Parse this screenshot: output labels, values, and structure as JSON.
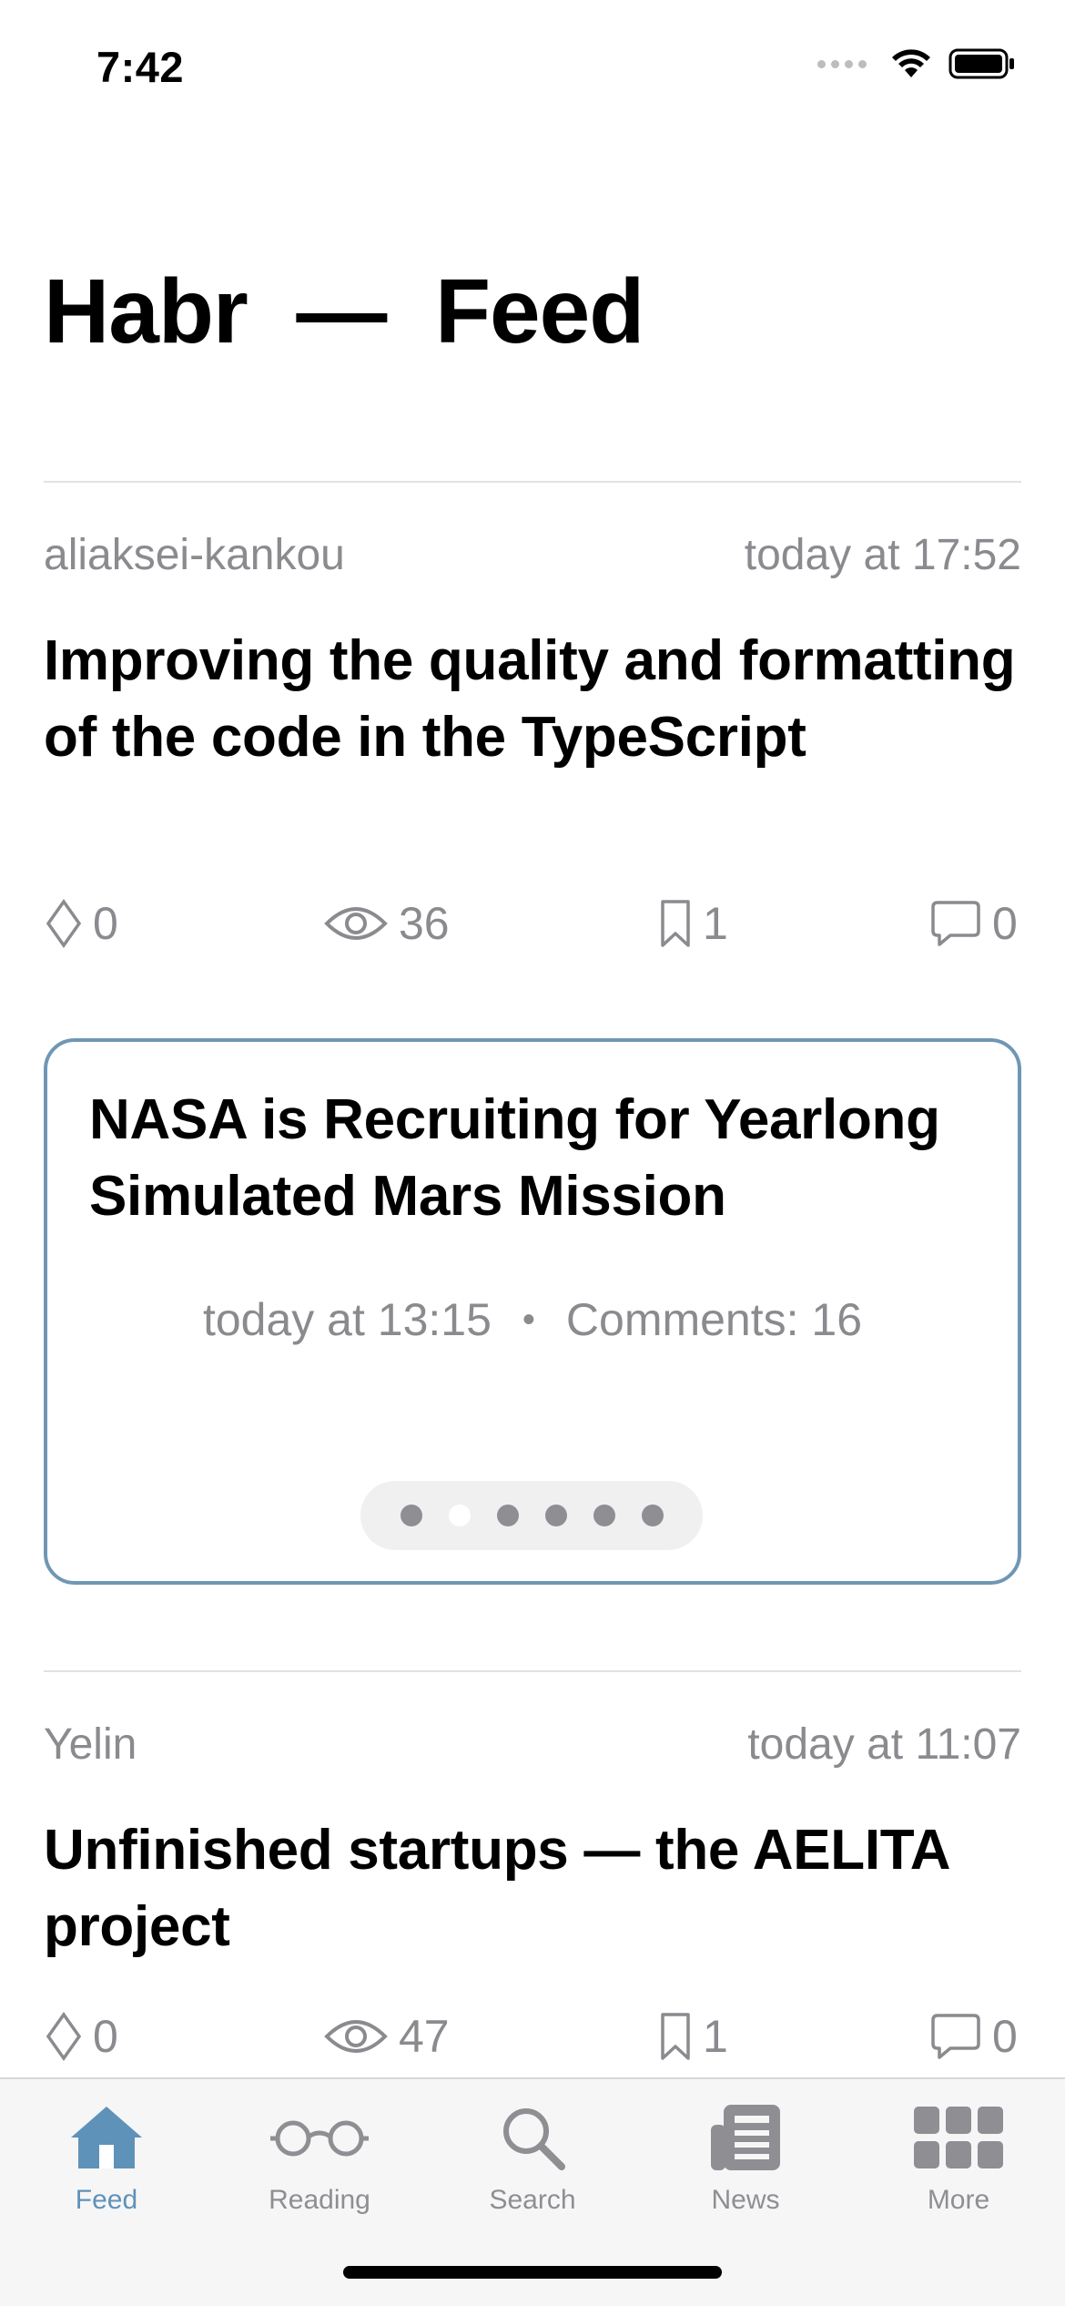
{
  "status_bar": {
    "time": "7:42"
  },
  "page": {
    "title": "Habr  —  Feed"
  },
  "articles": [
    {
      "author": "aliaksei-kankou",
      "time": "today at 17:52",
      "title": "Improving the quality and formatting of the code in the TypeScript",
      "rating": "0",
      "views": "36",
      "bookmarks": "1",
      "comments": "0"
    },
    {
      "author": "Yelin",
      "time": "today at 11:07",
      "title": "Unfinished startups — the AELITA project",
      "rating": "0",
      "views": "47",
      "bookmarks": "1",
      "comments": "0"
    }
  ],
  "carousel": {
    "title": "NASA is Recruiting for Yearlong Simulated Mars Mission",
    "time": "today at 13:15",
    "separator": "•",
    "comments": "Comments: 16",
    "page_count": 6,
    "active_page": 2
  },
  "tab_bar": {
    "tabs": [
      {
        "label": "Feed",
        "icon": "house-icon",
        "active": true
      },
      {
        "label": "Reading",
        "icon": "glasses-icon",
        "active": false
      },
      {
        "label": "Search",
        "icon": "magnifier-icon",
        "active": false
      },
      {
        "label": "News",
        "icon": "newspaper-icon",
        "active": false
      },
      {
        "label": "More",
        "icon": "grid-icon",
        "active": false
      }
    ]
  },
  "colors": {
    "accent": "#5f92b8",
    "card_border": "#6f97b4",
    "secondary_text": "#8a8a8f",
    "inactive_icon": "#8e8e93"
  }
}
